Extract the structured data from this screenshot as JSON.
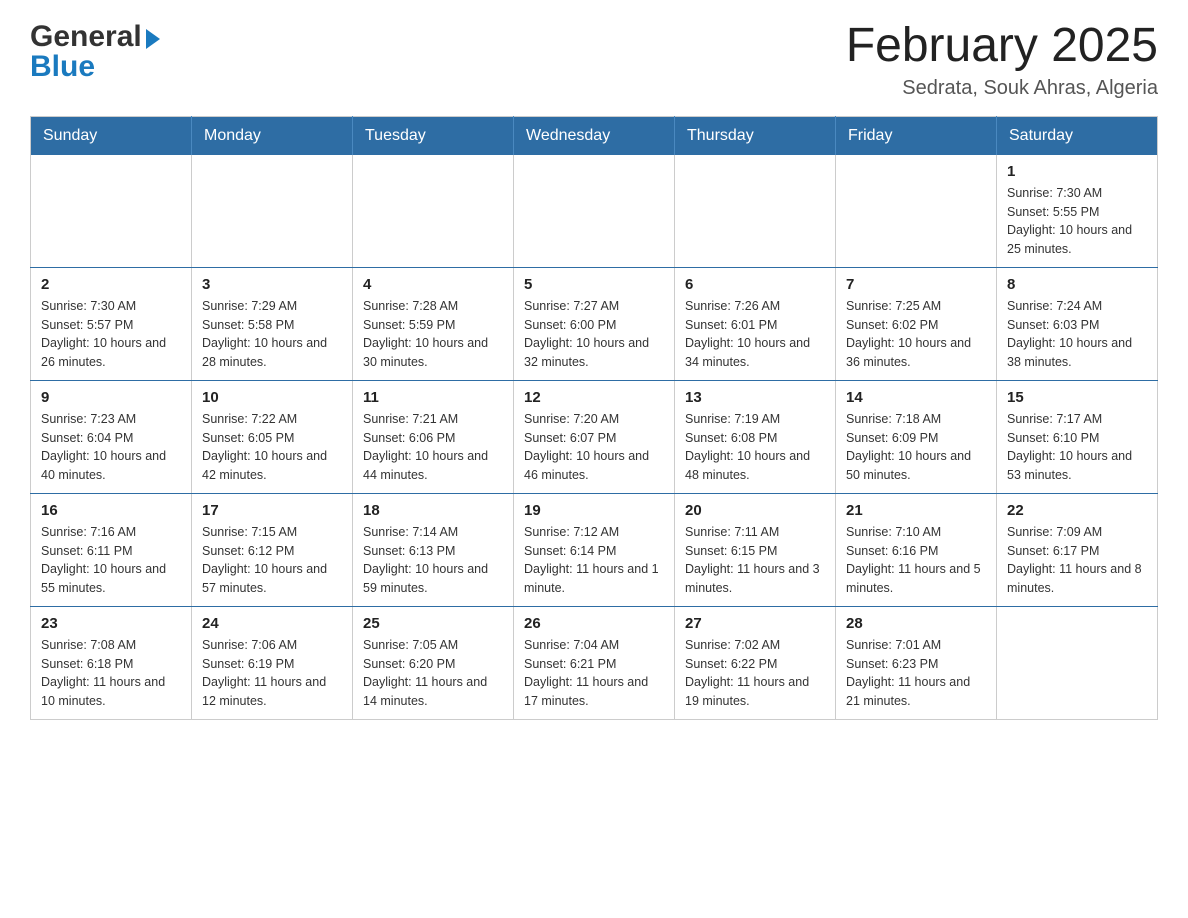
{
  "header": {
    "logo_general": "General",
    "logo_blue": "Blue",
    "month_title": "February 2025",
    "location": "Sedrata, Souk Ahras, Algeria"
  },
  "days_of_week": [
    "Sunday",
    "Monday",
    "Tuesday",
    "Wednesday",
    "Thursday",
    "Friday",
    "Saturday"
  ],
  "weeks": [
    [
      {
        "day": "",
        "info": ""
      },
      {
        "day": "",
        "info": ""
      },
      {
        "day": "",
        "info": ""
      },
      {
        "day": "",
        "info": ""
      },
      {
        "day": "",
        "info": ""
      },
      {
        "day": "",
        "info": ""
      },
      {
        "day": "1",
        "info": "Sunrise: 7:30 AM\nSunset: 5:55 PM\nDaylight: 10 hours and 25 minutes."
      }
    ],
    [
      {
        "day": "2",
        "info": "Sunrise: 7:30 AM\nSunset: 5:57 PM\nDaylight: 10 hours and 26 minutes."
      },
      {
        "day": "3",
        "info": "Sunrise: 7:29 AM\nSunset: 5:58 PM\nDaylight: 10 hours and 28 minutes."
      },
      {
        "day": "4",
        "info": "Sunrise: 7:28 AM\nSunset: 5:59 PM\nDaylight: 10 hours and 30 minutes."
      },
      {
        "day": "5",
        "info": "Sunrise: 7:27 AM\nSunset: 6:00 PM\nDaylight: 10 hours and 32 minutes."
      },
      {
        "day": "6",
        "info": "Sunrise: 7:26 AM\nSunset: 6:01 PM\nDaylight: 10 hours and 34 minutes."
      },
      {
        "day": "7",
        "info": "Sunrise: 7:25 AM\nSunset: 6:02 PM\nDaylight: 10 hours and 36 minutes."
      },
      {
        "day": "8",
        "info": "Sunrise: 7:24 AM\nSunset: 6:03 PM\nDaylight: 10 hours and 38 minutes."
      }
    ],
    [
      {
        "day": "9",
        "info": "Sunrise: 7:23 AM\nSunset: 6:04 PM\nDaylight: 10 hours and 40 minutes."
      },
      {
        "day": "10",
        "info": "Sunrise: 7:22 AM\nSunset: 6:05 PM\nDaylight: 10 hours and 42 minutes."
      },
      {
        "day": "11",
        "info": "Sunrise: 7:21 AM\nSunset: 6:06 PM\nDaylight: 10 hours and 44 minutes."
      },
      {
        "day": "12",
        "info": "Sunrise: 7:20 AM\nSunset: 6:07 PM\nDaylight: 10 hours and 46 minutes."
      },
      {
        "day": "13",
        "info": "Sunrise: 7:19 AM\nSunset: 6:08 PM\nDaylight: 10 hours and 48 minutes."
      },
      {
        "day": "14",
        "info": "Sunrise: 7:18 AM\nSunset: 6:09 PM\nDaylight: 10 hours and 50 minutes."
      },
      {
        "day": "15",
        "info": "Sunrise: 7:17 AM\nSunset: 6:10 PM\nDaylight: 10 hours and 53 minutes."
      }
    ],
    [
      {
        "day": "16",
        "info": "Sunrise: 7:16 AM\nSunset: 6:11 PM\nDaylight: 10 hours and 55 minutes."
      },
      {
        "day": "17",
        "info": "Sunrise: 7:15 AM\nSunset: 6:12 PM\nDaylight: 10 hours and 57 minutes."
      },
      {
        "day": "18",
        "info": "Sunrise: 7:14 AM\nSunset: 6:13 PM\nDaylight: 10 hours and 59 minutes."
      },
      {
        "day": "19",
        "info": "Sunrise: 7:12 AM\nSunset: 6:14 PM\nDaylight: 11 hours and 1 minute."
      },
      {
        "day": "20",
        "info": "Sunrise: 7:11 AM\nSunset: 6:15 PM\nDaylight: 11 hours and 3 minutes."
      },
      {
        "day": "21",
        "info": "Sunrise: 7:10 AM\nSunset: 6:16 PM\nDaylight: 11 hours and 5 minutes."
      },
      {
        "day": "22",
        "info": "Sunrise: 7:09 AM\nSunset: 6:17 PM\nDaylight: 11 hours and 8 minutes."
      }
    ],
    [
      {
        "day": "23",
        "info": "Sunrise: 7:08 AM\nSunset: 6:18 PM\nDaylight: 11 hours and 10 minutes."
      },
      {
        "day": "24",
        "info": "Sunrise: 7:06 AM\nSunset: 6:19 PM\nDaylight: 11 hours and 12 minutes."
      },
      {
        "day": "25",
        "info": "Sunrise: 7:05 AM\nSunset: 6:20 PM\nDaylight: 11 hours and 14 minutes."
      },
      {
        "day": "26",
        "info": "Sunrise: 7:04 AM\nSunset: 6:21 PM\nDaylight: 11 hours and 17 minutes."
      },
      {
        "day": "27",
        "info": "Sunrise: 7:02 AM\nSunset: 6:22 PM\nDaylight: 11 hours and 19 minutes."
      },
      {
        "day": "28",
        "info": "Sunrise: 7:01 AM\nSunset: 6:23 PM\nDaylight: 11 hours and 21 minutes."
      },
      {
        "day": "",
        "info": ""
      }
    ]
  ]
}
